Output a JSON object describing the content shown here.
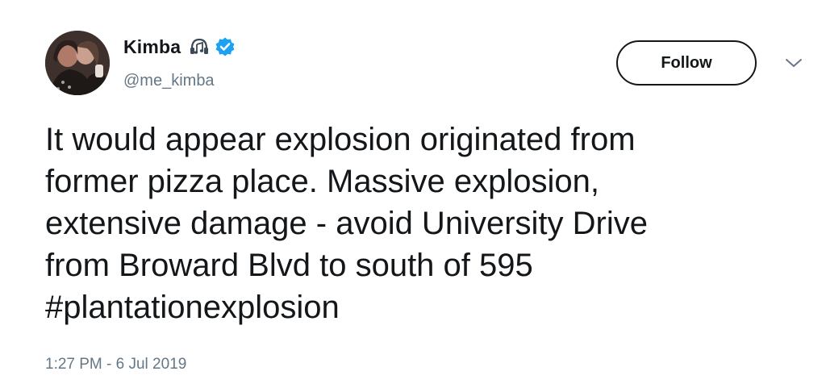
{
  "user": {
    "display_name": "Kimba",
    "handle": "@me_kimba",
    "verified": true,
    "name_icon": "music-note-icon",
    "verified_color": "#1da1f2"
  },
  "follow_button": {
    "label": "Follow"
  },
  "menu": {
    "icon": "chevron-down-icon"
  },
  "tweet": {
    "lines": [
      "It would appear explosion originated from",
      "former pizza place. Massive explosion,",
      "extensive damage - avoid University Drive",
      "from Broward Blvd to south of 595",
      "#plantationexplosion"
    ],
    "timestamp": "1:27 PM - 6 Jul 2019"
  },
  "colors": {
    "text": "#14171a",
    "secondary": "#657786",
    "accent": "#1da1f2"
  }
}
